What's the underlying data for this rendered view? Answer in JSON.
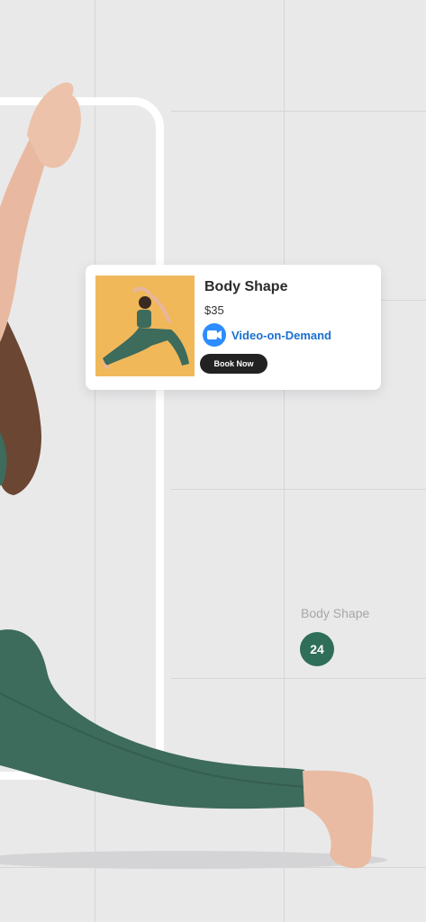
{
  "card": {
    "title": "Body Shape",
    "price": "$35",
    "delivery_label": "Video-on-Demand",
    "book_label": "Book Now",
    "icon": "video-camera-icon"
  },
  "side_panel": {
    "label": "Body Shape",
    "badge_value": "24"
  },
  "colors": {
    "background": "#e9e9ea",
    "accent_green": "#2f6e58",
    "legging_green": "#3d6b5c",
    "zoom_blue": "#2d8cff",
    "button_dark": "#222222",
    "photo_backdrop": "#f1b85a"
  }
}
